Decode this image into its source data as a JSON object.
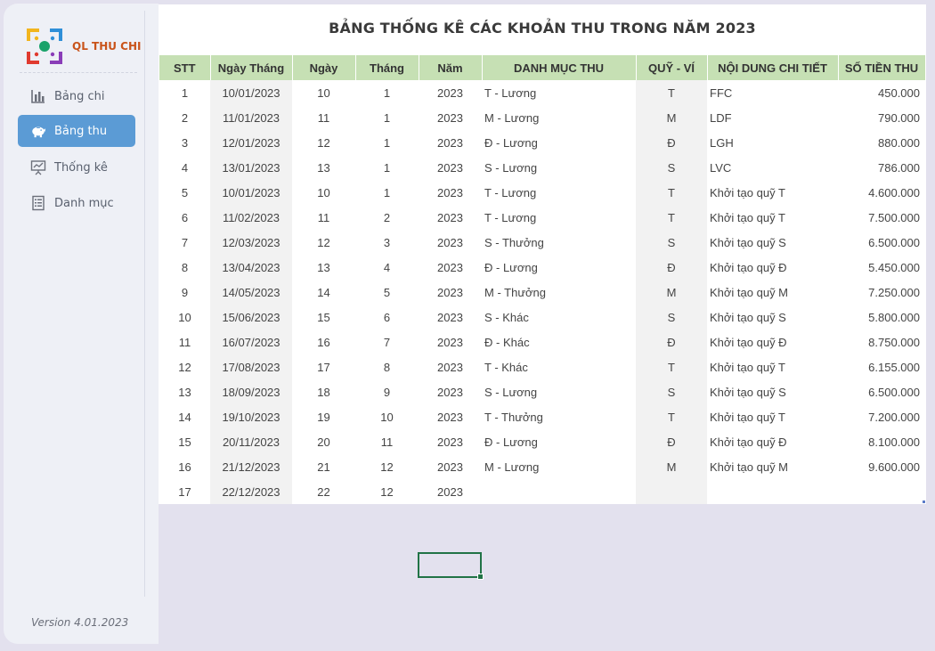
{
  "app": {
    "brand": "QL THU CHI",
    "version": "Version 4.01.2023"
  },
  "nav": [
    {
      "label": "Bảng chi",
      "icon": "bar-chart-icon",
      "active": false
    },
    {
      "label": "Bảng thu",
      "icon": "piggy-bank-icon",
      "active": true
    },
    {
      "label": "Thống kê",
      "icon": "presentation-chart-icon",
      "active": false
    },
    {
      "label": "Danh mục",
      "icon": "list-document-icon",
      "active": false
    }
  ],
  "sheet": {
    "title": "BẢNG THỐNG KÊ CÁC KHOẢN THU TRONG NĂM 2023",
    "headers": [
      "STT",
      "Ngày Tháng",
      "Ngày",
      "Tháng",
      "Năm",
      "DANH MỤC THU",
      "QUỸ - VÍ",
      "NỘI DUNG CHI TIẾT",
      "SỐ TIỀN THU"
    ],
    "rows": [
      [
        "1",
        "10/01/2023",
        "10",
        "1",
        "2023",
        "T - Lương",
        "T",
        "FFC",
        "450.000"
      ],
      [
        "2",
        "11/01/2023",
        "11",
        "1",
        "2023",
        "M - Lương",
        "M",
        "LDF",
        "790.000"
      ],
      [
        "3",
        "12/01/2023",
        "12",
        "1",
        "2023",
        "Đ - Lương",
        "Đ",
        "LGH",
        "880.000"
      ],
      [
        "4",
        "13/01/2023",
        "13",
        "1",
        "2023",
        "S - Lương",
        "S",
        "LVC",
        "786.000"
      ],
      [
        "5",
        "10/01/2023",
        "10",
        "1",
        "2023",
        "T - Lương",
        "T",
        "Khởi tạo quỹ T",
        "4.600.000"
      ],
      [
        "6",
        "11/02/2023",
        "11",
        "2",
        "2023",
        "T - Lương",
        "T",
        "Khởi tạo quỹ T",
        "7.500.000"
      ],
      [
        "7",
        "12/03/2023",
        "12",
        "3",
        "2023",
        "S - Thưởng",
        "S",
        "Khởi tạo quỹ S",
        "6.500.000"
      ],
      [
        "8",
        "13/04/2023",
        "13",
        "4",
        "2023",
        "Đ - Lương",
        "Đ",
        "Khởi tạo quỹ Đ",
        "5.450.000"
      ],
      [
        "9",
        "14/05/2023",
        "14",
        "5",
        "2023",
        "M - Thưởng",
        "M",
        "Khởi tạo quỹ M",
        "7.250.000"
      ],
      [
        "10",
        "15/06/2023",
        "15",
        "6",
        "2023",
        "S - Khác",
        "S",
        "Khởi tạo quỹ S",
        "5.800.000"
      ],
      [
        "11",
        "16/07/2023",
        "16",
        "7",
        "2023",
        "Đ - Khác",
        "Đ",
        "Khởi tạo quỹ Đ",
        "8.750.000"
      ],
      [
        "12",
        "17/08/2023",
        "17",
        "8",
        "2023",
        "T - Khác",
        "T",
        "Khởi tạo quỹ T",
        "6.155.000"
      ],
      [
        "13",
        "18/09/2023",
        "18",
        "9",
        "2023",
        "S - Lương",
        "S",
        "Khởi tạo quỹ S",
        "6.500.000"
      ],
      [
        "14",
        "19/10/2023",
        "19",
        "10",
        "2023",
        "T - Thưởng",
        "T",
        "Khởi tạo quỹ T",
        "7.200.000"
      ],
      [
        "15",
        "20/11/2023",
        "20",
        "11",
        "2023",
        "Đ - Lương",
        "Đ",
        "Khởi tạo quỹ Đ",
        "8.100.000"
      ],
      [
        "16",
        "21/12/2023",
        "21",
        "12",
        "2023",
        "M - Lương",
        "M",
        "Khởi tạo quỹ M",
        "9.600.000"
      ],
      [
        "17",
        "22/12/2023",
        "22",
        "12",
        "2023",
        "",
        "",
        "",
        ""
      ]
    ]
  },
  "colors": {
    "header_bg": "#c6e0b4",
    "nav_active": "#5b9bd5",
    "brand": "#c9541b",
    "selection": "#217346"
  }
}
